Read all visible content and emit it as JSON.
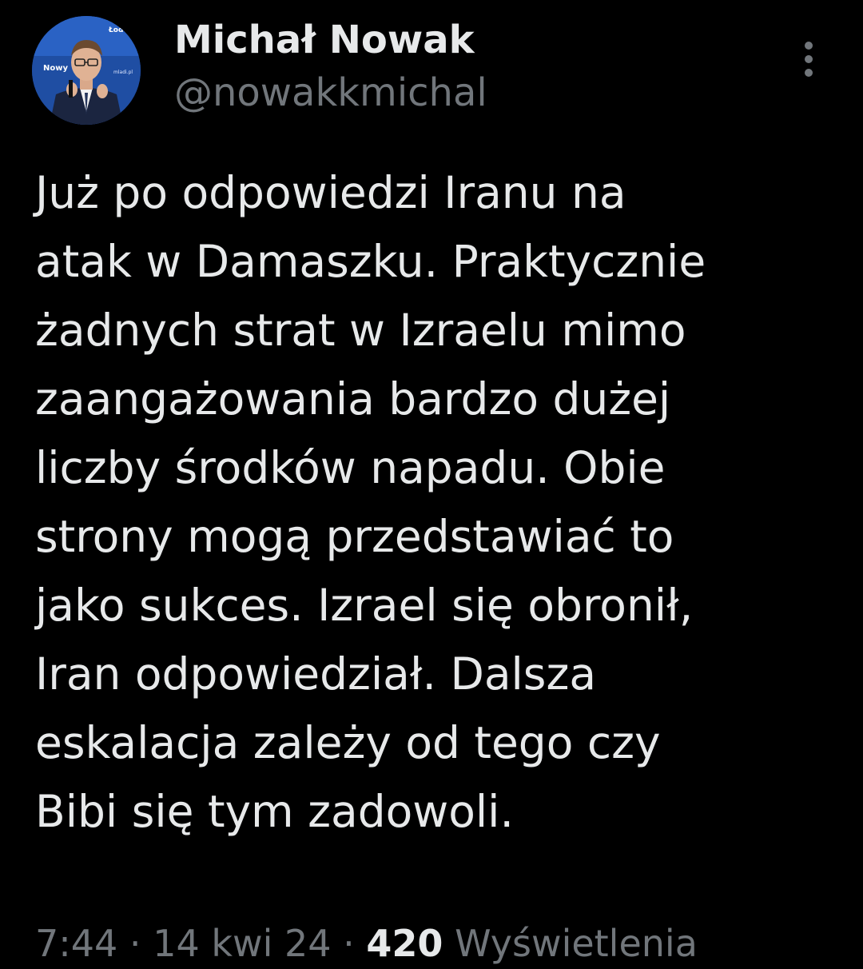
{
  "author": {
    "name": "Michał Nowak",
    "handle": "@nowakkmichal"
  },
  "tweet": {
    "text": "Już po odpowiedzi Iranu na\natak w Damaszku. Praktycznie\nżadnych strat w Izraelu mimo\nzaangażowania bardzo dużej\nliczby środków napadu. Obie\nstrony mogą przedstawiać to\njako sukces. Izrael się obronił,\nIran odpowiedział. Dalsza\neskalacja zależy od tego czy\nBibi się tym zadowoli."
  },
  "meta": {
    "time": "7:44",
    "separator": " · ",
    "date": "14 kwi 24",
    "views_count": "420",
    "views_label": "Wyświetlenia"
  },
  "avatar": {
    "logo_text": "Nowy",
    "corner_text": "Łod",
    "caption_text": "mladi.pl"
  },
  "icons": {
    "more": "more-vertical-icon"
  },
  "colors": {
    "background": "#000000",
    "primary_text": "#e7e9ea",
    "secondary_text": "#71767b"
  }
}
